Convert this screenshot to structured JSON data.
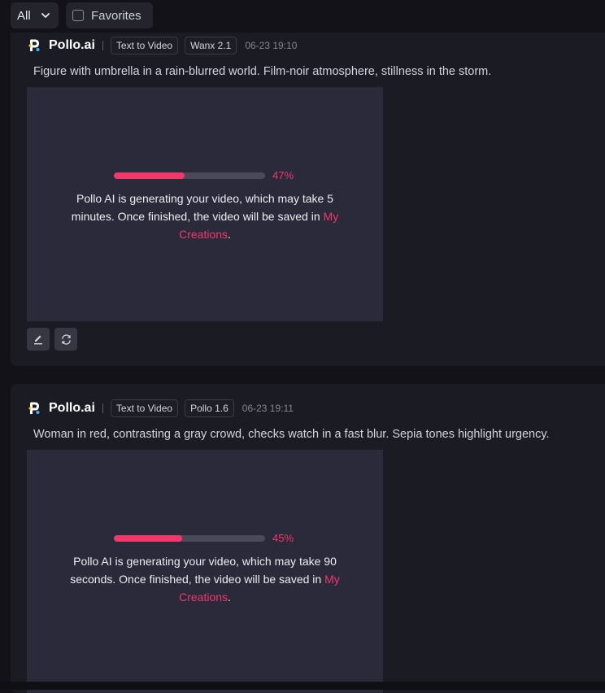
{
  "filters": {
    "type_dropdown": "All",
    "favorites_label": "Favorites"
  },
  "colors": {
    "accent": "#f0386b",
    "card_bg": "#1b1b23",
    "preview_bg": "#2b2a3a"
  },
  "tasks": [
    {
      "brand": "Pollo.ai",
      "mode": "Text to Video",
      "model": "Wanx 2.1",
      "time": "06-23 19:10",
      "prompt": "Figure with umbrella in a rain-blurred world. Film-noir atmosphere, stillness in the storm.",
      "progress": 0.47,
      "progress_label": "47%",
      "message_before": "Pollo AI is generating your video, which may take 5 minutes. Once finished, the video will be saved in ",
      "link_text": "My Creations",
      "message_after": ".",
      "actions": [
        "edit-icon",
        "regenerate-icon"
      ]
    },
    {
      "brand": "Pollo.ai",
      "mode": "Text to Video",
      "model": "Pollo 1.6",
      "time": "06-23 19:11",
      "prompt": "Woman in red, contrasting a gray crowd, checks watch in a fast blur. Sepia tones highlight urgency.",
      "progress": 0.45,
      "progress_label": "45%",
      "message_before": "Pollo AI is generating your video, which may take 90 seconds. Once finished, the video will be saved in ",
      "link_text": "My Creations",
      "message_after": "."
    }
  ]
}
